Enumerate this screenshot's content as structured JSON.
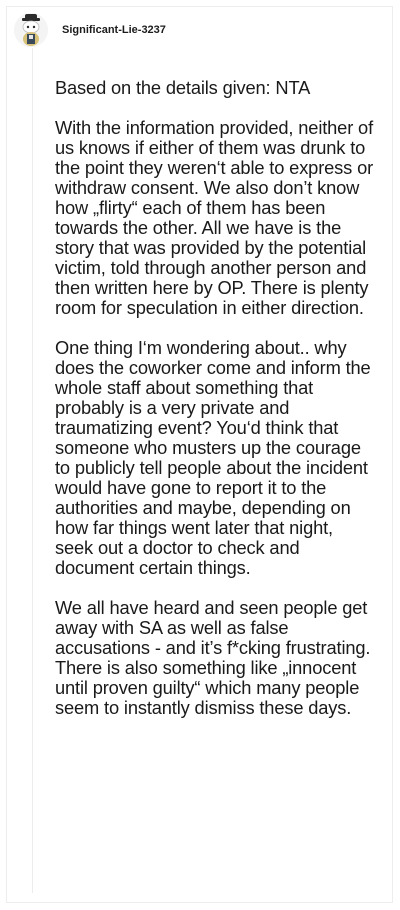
{
  "comment": {
    "username": "Significant-Lie-3237",
    "avatar_icon": "snoo-avatar-icon",
    "paragraphs": [
      "Based on the details given: NTA",
      "With the information provided, neither of us knows if either of them was drunk to the point they weren‘t able to express or withdraw consent. We also don’t know how „flirty“ each of them has been towards the other. All we have is the story that was provided by the potential victim, told through another person and then written here by OP. There is plenty room for speculation in either direction.",
      "One thing I‘m wondering about.. why does the coworker come and inform the whole staff about something that probably is a very private and traumatizing event? You‘d think that someone who musters up the courage to publicly tell people about the incident would have gone to report it to the authorities and maybe, depending on how far things went later that night, seek out a doctor to check and document certain things.",
      "We all have heard and seen people get away with SA as well as false accusations - and it’s f*cking frustrating. There is also something like „innocent until proven guilty“ which many people seem to instantly dismiss these days."
    ]
  },
  "colors": {
    "text": "#1a1a1b",
    "border": "#ededed",
    "thread_line": "#ececec"
  }
}
